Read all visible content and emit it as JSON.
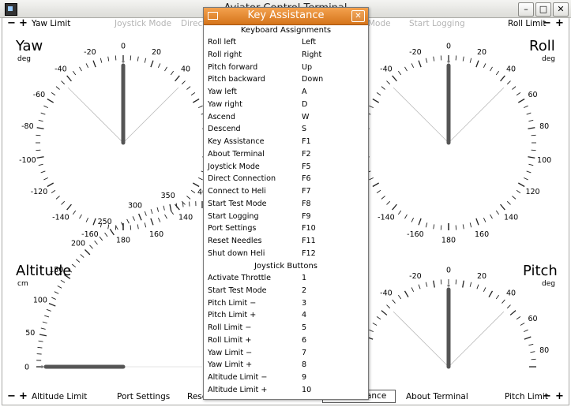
{
  "window": {
    "title": "Aviator Control Terminal"
  },
  "toolbar": {
    "minus": "−",
    "plus": "+",
    "yaw_limit": "Yaw Limit",
    "joystick_mode": "Joystick Mode",
    "direct": "Direct",
    "mode": "Mode",
    "start_logging": "Start Logging",
    "roll_limit": "Roll Limit"
  },
  "bottom": {
    "altitude_limit": "Altitude Limit",
    "port_settings": "Port Settings",
    "reset": "Rese",
    "key_assistance": "ance",
    "about_terminal": "About Terminal",
    "pitch_limit": "Pitch Limit"
  },
  "gauges": {
    "yaw": {
      "title": "Yaw",
      "unit": "deg",
      "value": 0
    },
    "roll": {
      "title": "Roll",
      "unit": "deg",
      "value": 0
    },
    "altitude": {
      "title": "Altitude",
      "unit": "cm",
      "value": 0
    },
    "pitch": {
      "title": "Pitch",
      "unit": "deg",
      "value": 0
    },
    "yaw_labels": [
      "0",
      "20",
      "40",
      "-20",
      "-40",
      "-60",
      "-80",
      "-100",
      "-120",
      "-140",
      "-160",
      "180",
      "160",
      "140"
    ],
    "roll_labels": [
      "0",
      "20",
      "40",
      "60",
      "80",
      "100",
      "120",
      "140",
      "160",
      "180",
      "-160",
      "-140",
      "-20",
      "-40"
    ],
    "altitude_labels": [
      "0",
      "50",
      "100",
      "150",
      "200",
      "250",
      "300",
      "350",
      "40"
    ],
    "pitch_labels": [
      "0",
      "20",
      "40",
      "60",
      "80",
      "-20",
      "-40"
    ]
  },
  "dialog": {
    "title": "Key Assistance",
    "keyboard_header": "Keyboard Assignments",
    "joystick_header": "Joystick Buttons",
    "keyboard": [
      {
        "action": "Roll left",
        "key": "Left"
      },
      {
        "action": "Roll right",
        "key": "Right"
      },
      {
        "action": "Pitch forward",
        "key": "Up"
      },
      {
        "action": "Pitch backward",
        "key": "Down"
      },
      {
        "action": "Yaw left",
        "key": "A"
      },
      {
        "action": "Yaw right",
        "key": "D"
      },
      {
        "action": "Ascend",
        "key": "W"
      },
      {
        "action": "Descend",
        "key": "S"
      },
      {
        "action": "Key Assistance",
        "key": "F1"
      },
      {
        "action": "About Terminal",
        "key": "F2"
      },
      {
        "action": "Joystick Mode",
        "key": "F5"
      },
      {
        "action": "Direct Connection",
        "key": "F6"
      },
      {
        "action": "Connect to Heli",
        "key": "F7"
      },
      {
        "action": "Start Test Mode",
        "key": "F8"
      },
      {
        "action": "Start Logging",
        "key": "F9"
      },
      {
        "action": "Port Settings",
        "key": "F10"
      },
      {
        "action": "Reset Needles",
        "key": "F11"
      },
      {
        "action": "Shut down Heli",
        "key": "F12"
      }
    ],
    "joystick": [
      {
        "action": "Activate Throttle",
        "key": "1"
      },
      {
        "action": "Start Test Mode",
        "key": "2"
      },
      {
        "action": "Pitch Limit  −",
        "key": "3"
      },
      {
        "action": "Pitch Limit +",
        "key": "4"
      },
      {
        "action": "Roll Limit  −",
        "key": "5"
      },
      {
        "action": "Roll Limit +",
        "key": "6"
      },
      {
        "action": "Yaw Limit  −",
        "key": "7"
      },
      {
        "action": "Yaw Limit +",
        "key": "8"
      },
      {
        "action": "Altitude Limit  −",
        "key": "9"
      },
      {
        "action": "Altitude Limit +",
        "key": "10"
      }
    ]
  }
}
